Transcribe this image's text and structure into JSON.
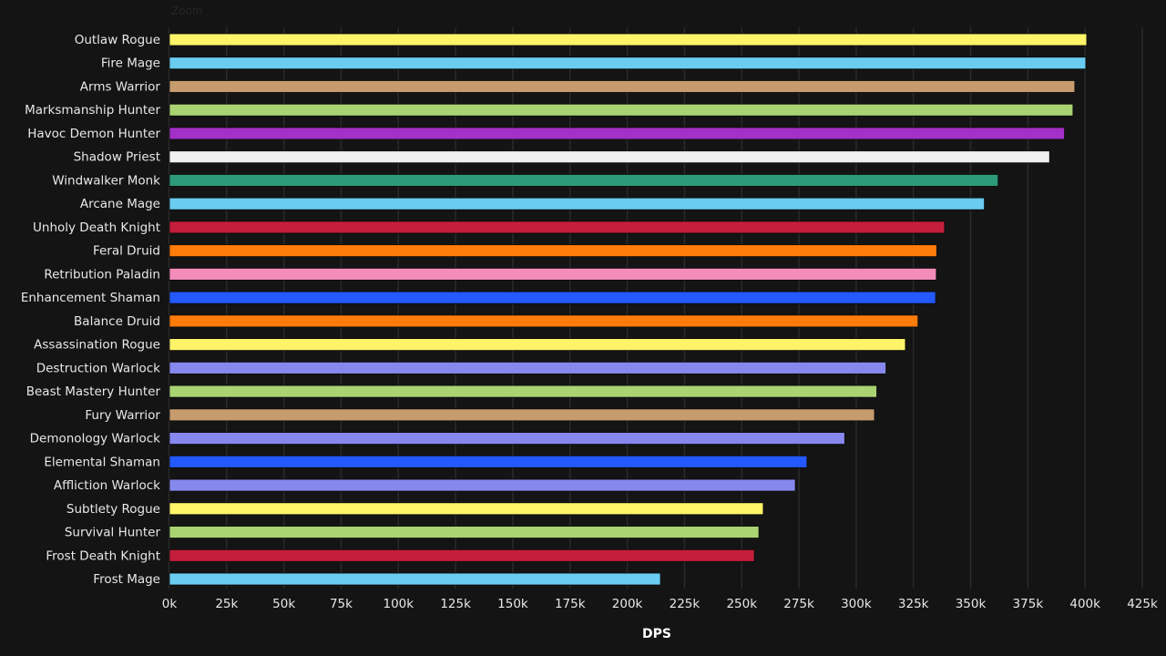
{
  "zoom_label": "Zoom",
  "chart_data": {
    "type": "bar",
    "orientation": "horizontal",
    "title": "",
    "xlabel": "DPS",
    "ylabel": "",
    "xlim": [
      0,
      425000
    ],
    "x_ticks": [
      0,
      25000,
      50000,
      75000,
      100000,
      125000,
      150000,
      175000,
      200000,
      225000,
      250000,
      275000,
      300000,
      325000,
      350000,
      375000,
      400000,
      425000
    ],
    "x_tick_labels": [
      "0k",
      "25k",
      "50k",
      "75k",
      "100k",
      "125k",
      "150k",
      "175k",
      "200k",
      "225k",
      "250k",
      "275k",
      "300k",
      "325k",
      "350k",
      "375k",
      "400k",
      "425k"
    ],
    "grid": true,
    "legend": "none",
    "categories": [
      "Outlaw Rogue",
      "Fire Mage",
      "Arms Warrior",
      "Marksmanship Hunter",
      "Havoc Demon Hunter",
      "Shadow Priest",
      "Windwalker Monk",
      "Arcane Mage",
      "Unholy Death Knight",
      "Feral Druid",
      "Retribution Paladin",
      "Enhancement Shaman",
      "Balance Druid",
      "Assassination Rogue",
      "Destruction Warlock",
      "Beast Mastery Hunter",
      "Fury Warrior",
      "Demonology Warlock",
      "Elemental Shaman",
      "Affliction Warlock",
      "Subtlety Rogue",
      "Survival Hunter",
      "Frost Death Knight",
      "Frost Mage"
    ],
    "values": [
      400700,
      400300,
      395500,
      394700,
      391000,
      384500,
      362000,
      356000,
      338600,
      335200,
      335000,
      334700,
      327000,
      321500,
      313000,
      309000,
      308000,
      295000,
      278500,
      273400,
      259400,
      257500,
      255500,
      214500
    ],
    "colors": [
      "#FFF468",
      "#69CCF0",
      "#C69B6D",
      "#AAD372",
      "#A330C9",
      "#F0F0F0",
      "#2D9B78",
      "#69CCF0",
      "#C41E3A",
      "#FF7C0A",
      "#F48CBA",
      "#2459FF",
      "#FF7C0A",
      "#FFF468",
      "#8788EE",
      "#AAD372",
      "#C69B6D",
      "#8788EE",
      "#2459FF",
      "#8788EE",
      "#FFF468",
      "#AAD372",
      "#C41E3A",
      "#69CCF0"
    ]
  }
}
